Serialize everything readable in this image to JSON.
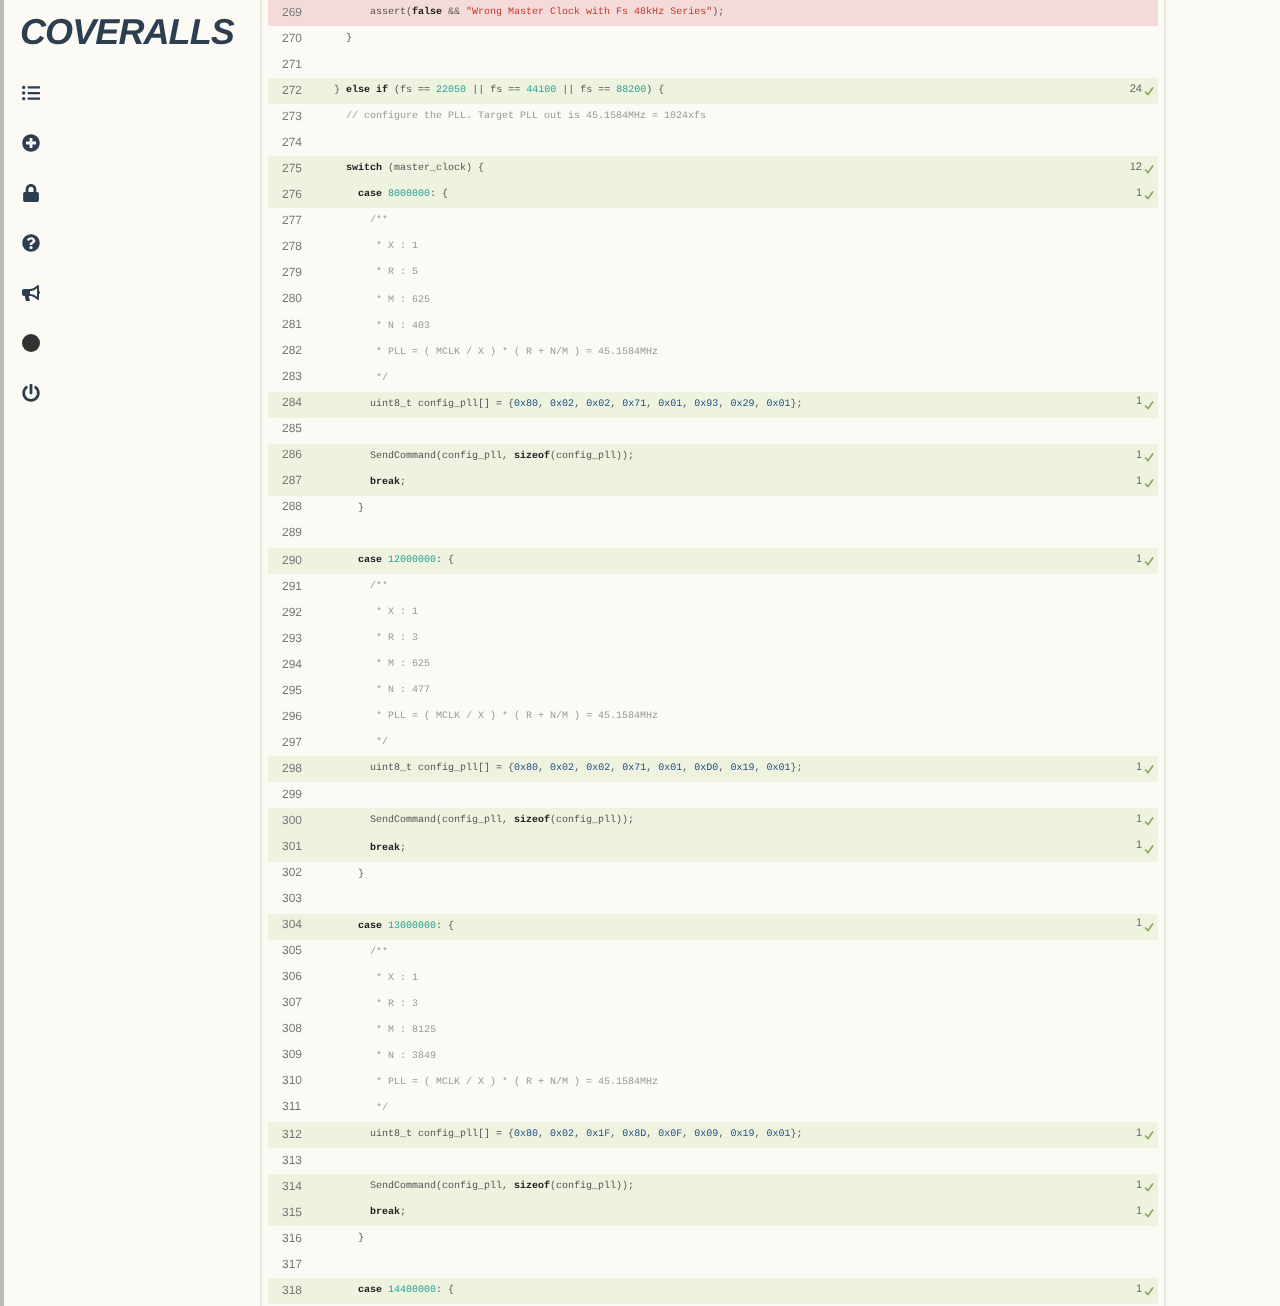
{
  "logo": "COVERALLS",
  "sidebar": {
    "items": [
      {
        "kind": "list"
      },
      {
        "kind": "plus"
      },
      {
        "kind": "lock"
      },
      {
        "kind": "help"
      },
      {
        "kind": "announce"
      },
      {
        "kind": "avatar"
      },
      {
        "kind": "power"
      }
    ]
  },
  "lines": [
    {
      "number": "269",
      "covered": false,
      "missed": true,
      "tokens": [
        {
          "kind": "plain",
          "text": "        assert("
        },
        {
          "kind": "keyword",
          "text": "false"
        },
        {
          "kind": "plain",
          "text": " && "
        },
        {
          "kind": "string",
          "text": "\"Wrong Master Clock with Fs 48kHz Series\""
        },
        {
          "kind": "plain",
          "text": ");"
        }
      ]
    },
    {
      "number": "270",
      "covered": false,
      "missed": false,
      "tokens": [
        {
          "kind": "plain",
          "text": "    }"
        }
      ]
    },
    {
      "number": "271",
      "covered": false,
      "missed": false
    },
    {
      "number": "272",
      "covered": true,
      "missed": false,
      "hits": "24",
      "tokens": [
        {
          "kind": "plain",
          "text": "  } "
        },
        {
          "kind": "keyword",
          "text": "else if"
        },
        {
          "kind": "plain",
          "text": " (fs == "
        },
        {
          "kind": "number",
          "text": "22050"
        },
        {
          "kind": "plain",
          "text": " || fs == "
        },
        {
          "kind": "number",
          "text": "44100"
        },
        {
          "kind": "plain",
          "text": " || fs == "
        },
        {
          "kind": "number",
          "text": "88200"
        },
        {
          "kind": "plain",
          "text": ") {"
        }
      ]
    },
    {
      "number": "273",
      "covered": false,
      "missed": false,
      "tokens": [
        {
          "kind": "comment",
          "text": "    // configure the PLL. Target PLL out is 45.1584MHz = 1024xfs"
        }
      ]
    },
    {
      "number": "274",
      "covered": false,
      "missed": false
    },
    {
      "number": "275",
      "covered": true,
      "missed": false,
      "hits": "12",
      "tokens": [
        {
          "kind": "keyword",
          "text": "    switch"
        },
        {
          "kind": "plain",
          "text": " (master_clock) {"
        }
      ]
    },
    {
      "number": "276",
      "covered": true,
      "missed": false,
      "hits": "1",
      "tokens": [
        {
          "kind": "keyword",
          "text": "      case"
        },
        {
          "kind": "number",
          "text": " 8000000"
        },
        {
          "kind": "plain",
          "text": ": {"
        }
      ]
    },
    {
      "number": "277",
      "covered": false,
      "missed": false,
      "tokens": [
        {
          "kind": "comment",
          "text": "        /**"
        }
      ]
    },
    {
      "number": "278",
      "covered": false,
      "missed": false,
      "tokens": [
        {
          "kind": "comment",
          "text": "         * X : 1"
        }
      ]
    },
    {
      "number": "279",
      "covered": false,
      "missed": false,
      "tokens": [
        {
          "kind": "comment",
          "text": "         * R : 5"
        }
      ]
    },
    {
      "number": "280",
      "covered": false,
      "missed": false,
      "tokens": [
        {
          "kind": "comment",
          "text": "         * M : 625"
        }
      ]
    },
    {
      "number": "281",
      "covered": false,
      "missed": false,
      "tokens": [
        {
          "kind": "comment",
          "text": "         * N : 403"
        }
      ]
    },
    {
      "number": "282",
      "covered": false,
      "missed": false,
      "tokens": [
        {
          "kind": "comment",
          "text": "         * PLL = ( MCLK / X ) * ( R + N/M ) = 45.1584MHz"
        }
      ]
    },
    {
      "number": "283",
      "covered": false,
      "missed": false,
      "tokens": [
        {
          "kind": "comment",
          "text": "         */"
        }
      ]
    },
    {
      "number": "284",
      "covered": true,
      "missed": false,
      "hits": "1",
      "tokens": [
        {
          "kind": "plain",
          "text": "        uint8_t config_pll[] = {"
        },
        {
          "kind": "hex",
          "text": "0x80"
        },
        {
          "kind": "plain",
          "text": ", "
        },
        {
          "kind": "hex",
          "text": "0x02"
        },
        {
          "kind": "plain",
          "text": ", "
        },
        {
          "kind": "hex",
          "text": "0x02"
        },
        {
          "kind": "plain",
          "text": ", "
        },
        {
          "kind": "hex",
          "text": "0x71"
        },
        {
          "kind": "plain",
          "text": ", "
        },
        {
          "kind": "hex",
          "text": "0x01"
        },
        {
          "kind": "plain",
          "text": ", "
        },
        {
          "kind": "hex",
          "text": "0x93"
        },
        {
          "kind": "plain",
          "text": ", "
        },
        {
          "kind": "hex",
          "text": "0x29"
        },
        {
          "kind": "plain",
          "text": ", "
        },
        {
          "kind": "hex",
          "text": "0x01"
        },
        {
          "kind": "plain",
          "text": "};"
        }
      ]
    },
    {
      "number": "285",
      "covered": false,
      "missed": false
    },
    {
      "number": "286",
      "covered": true,
      "missed": false,
      "hits": "1",
      "tokens": [
        {
          "kind": "plain",
          "text": "        SendCommand(config_pll, "
        },
        {
          "kind": "keyword",
          "text": "sizeof"
        },
        {
          "kind": "plain",
          "text": "(config_pll));"
        }
      ]
    },
    {
      "number": "287",
      "covered": true,
      "missed": false,
      "hits": "1",
      "tokens": [
        {
          "kind": "keyword",
          "text": "        break"
        },
        {
          "kind": "plain",
          "text": ";"
        }
      ]
    },
    {
      "number": "288",
      "covered": false,
      "missed": false,
      "tokens": [
        {
          "kind": "plain",
          "text": "      }"
        }
      ]
    },
    {
      "number": "289",
      "covered": false,
      "missed": false
    },
    {
      "number": "290",
      "covered": true,
      "missed": false,
      "hits": "1",
      "tokens": [
        {
          "kind": "keyword",
          "text": "      case"
        },
        {
          "kind": "number",
          "text": " 12000000"
        },
        {
          "kind": "plain",
          "text": ": {"
        }
      ]
    },
    {
      "number": "291",
      "covered": false,
      "missed": false,
      "tokens": [
        {
          "kind": "comment",
          "text": "        /**"
        }
      ]
    },
    {
      "number": "292",
      "covered": false,
      "missed": false,
      "tokens": [
        {
          "kind": "comment",
          "text": "         * X : 1"
        }
      ]
    },
    {
      "number": "293",
      "covered": false,
      "missed": false,
      "tokens": [
        {
          "kind": "comment",
          "text": "         * R : 3"
        }
      ]
    },
    {
      "number": "294",
      "covered": false,
      "missed": false,
      "tokens": [
        {
          "kind": "comment",
          "text": "         * M : 625"
        }
      ]
    },
    {
      "number": "295",
      "covered": false,
      "missed": false,
      "tokens": [
        {
          "kind": "comment",
          "text": "         * N : 477"
        }
      ]
    },
    {
      "number": "296",
      "covered": false,
      "missed": false,
      "tokens": [
        {
          "kind": "comment",
          "text": "         * PLL = ( MCLK / X ) * ( R + N/M ) = 45.1584MHz"
        }
      ]
    },
    {
      "number": "297",
      "covered": false,
      "missed": false,
      "tokens": [
        {
          "kind": "comment",
          "text": "         */"
        }
      ]
    },
    {
      "number": "298",
      "covered": true,
      "missed": false,
      "hits": "1",
      "tokens": [
        {
          "kind": "plain",
          "text": "        uint8_t config_pll[] = {"
        },
        {
          "kind": "hex",
          "text": "0x80"
        },
        {
          "kind": "plain",
          "text": ", "
        },
        {
          "kind": "hex",
          "text": "0x02"
        },
        {
          "kind": "plain",
          "text": ", "
        },
        {
          "kind": "hex",
          "text": "0x02"
        },
        {
          "kind": "plain",
          "text": ", "
        },
        {
          "kind": "hex",
          "text": "0x71"
        },
        {
          "kind": "plain",
          "text": ", "
        },
        {
          "kind": "hex",
          "text": "0x01"
        },
        {
          "kind": "plain",
          "text": ", "
        },
        {
          "kind": "hex",
          "text": "0xD0"
        },
        {
          "kind": "plain",
          "text": ", "
        },
        {
          "kind": "hex",
          "text": "0x19"
        },
        {
          "kind": "plain",
          "text": ", "
        },
        {
          "kind": "hex",
          "text": "0x01"
        },
        {
          "kind": "plain",
          "text": "};"
        }
      ]
    },
    {
      "number": "299",
      "covered": false,
      "missed": false
    },
    {
      "number": "300",
      "covered": true,
      "missed": false,
      "hits": "1",
      "tokens": [
        {
          "kind": "plain",
          "text": "        SendCommand(config_pll, "
        },
        {
          "kind": "keyword",
          "text": "sizeof"
        },
        {
          "kind": "plain",
          "text": "(config_pll));"
        }
      ]
    },
    {
      "number": "301",
      "covered": true,
      "missed": false,
      "hits": "1",
      "tokens": [
        {
          "kind": "keyword",
          "text": "        break"
        },
        {
          "kind": "plain",
          "text": ";"
        }
      ]
    },
    {
      "number": "302",
      "covered": false,
      "missed": false,
      "tokens": [
        {
          "kind": "plain",
          "text": "      }"
        }
      ]
    },
    {
      "number": "303",
      "covered": false,
      "missed": false
    },
    {
      "number": "304",
      "covered": true,
      "missed": false,
      "hits": "1",
      "tokens": [
        {
          "kind": "keyword",
          "text": "      case"
        },
        {
          "kind": "number",
          "text": " 13000000"
        },
        {
          "kind": "plain",
          "text": ": {"
        }
      ]
    },
    {
      "number": "305",
      "covered": false,
      "missed": false,
      "tokens": [
        {
          "kind": "comment",
          "text": "        /**"
        }
      ]
    },
    {
      "number": "306",
      "covered": false,
      "missed": false,
      "tokens": [
        {
          "kind": "comment",
          "text": "         * X : 1"
        }
      ]
    },
    {
      "number": "307",
      "covered": false,
      "missed": false,
      "tokens": [
        {
          "kind": "comment",
          "text": "         * R : 3"
        }
      ]
    },
    {
      "number": "308",
      "covered": false,
      "missed": false,
      "tokens": [
        {
          "kind": "comment",
          "text": "         * M : 8125"
        }
      ]
    },
    {
      "number": "309",
      "covered": false,
      "missed": false,
      "tokens": [
        {
          "kind": "comment",
          "text": "         * N : 3849"
        }
      ]
    },
    {
      "number": "310",
      "covered": false,
      "missed": false,
      "tokens": [
        {
          "kind": "comment",
          "text": "         * PLL = ( MCLK / X ) * ( R + N/M ) = 45.1584MHz"
        }
      ]
    },
    {
      "number": "311",
      "covered": false,
      "missed": false,
      "tokens": [
        {
          "kind": "comment",
          "text": "         */"
        }
      ]
    },
    {
      "number": "312",
      "covered": true,
      "missed": false,
      "hits": "1",
      "tokens": [
        {
          "kind": "plain",
          "text": "        uint8_t config_pll[] = {"
        },
        {
          "kind": "hex",
          "text": "0x80"
        },
        {
          "kind": "plain",
          "text": ", "
        },
        {
          "kind": "hex",
          "text": "0x02"
        },
        {
          "kind": "plain",
          "text": ", "
        },
        {
          "kind": "hex",
          "text": "0x1F"
        },
        {
          "kind": "plain",
          "text": ", "
        },
        {
          "kind": "hex",
          "text": "0x8D"
        },
        {
          "kind": "plain",
          "text": ", "
        },
        {
          "kind": "hex",
          "text": "0x0F"
        },
        {
          "kind": "plain",
          "text": ", "
        },
        {
          "kind": "hex",
          "text": "0x09"
        },
        {
          "kind": "plain",
          "text": ", "
        },
        {
          "kind": "hex",
          "text": "0x19"
        },
        {
          "kind": "plain",
          "text": ", "
        },
        {
          "kind": "hex",
          "text": "0x01"
        },
        {
          "kind": "plain",
          "text": "};"
        }
      ]
    },
    {
      "number": "313",
      "covered": false,
      "missed": false
    },
    {
      "number": "314",
      "covered": true,
      "missed": false,
      "hits": "1",
      "tokens": [
        {
          "kind": "plain",
          "text": "        SendCommand(config_pll, "
        },
        {
          "kind": "keyword",
          "text": "sizeof"
        },
        {
          "kind": "plain",
          "text": "(config_pll));"
        }
      ]
    },
    {
      "number": "315",
      "covered": true,
      "missed": false,
      "hits": "1",
      "tokens": [
        {
          "kind": "keyword",
          "text": "        break"
        },
        {
          "kind": "plain",
          "text": ";"
        }
      ]
    },
    {
      "number": "316",
      "covered": false,
      "missed": false,
      "tokens": [
        {
          "kind": "plain",
          "text": "      }"
        }
      ]
    },
    {
      "number": "317",
      "covered": false,
      "missed": false
    },
    {
      "number": "318",
      "covered": true,
      "missed": false,
      "hits": "1",
      "tokens": [
        {
          "kind": "keyword",
          "text": "      case"
        },
        {
          "kind": "number",
          "text": " 14400000"
        },
        {
          "kind": "plain",
          "text": ": {"
        }
      ]
    }
  ]
}
